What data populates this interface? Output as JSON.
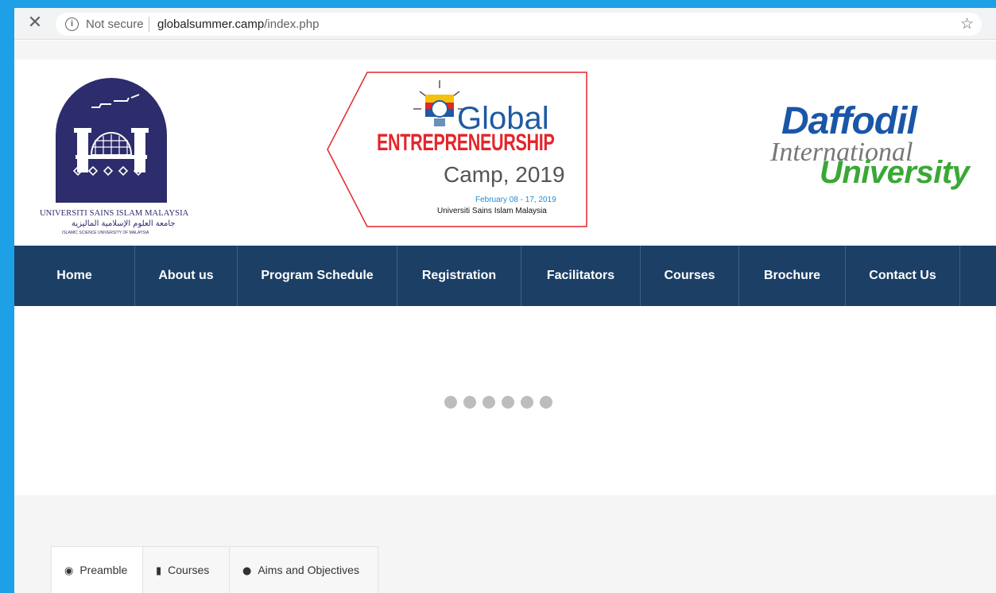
{
  "browser": {
    "close_glyph": "✕",
    "info_glyph": "i",
    "security_label": "Not secure",
    "url_host": "globalsummer.camp",
    "url_path": "/index.php",
    "star_glyph": "☆"
  },
  "header": {
    "usim": {
      "name": "UNIVERSITI SAINS ISLAM MALAYSIA",
      "arabic": "جامعة العلوم الإسلامية الماليزية",
      "english": "ISLAMIC SCIENCE UNIVERSITY OF MALAYSIA"
    },
    "gec": {
      "global": "Global",
      "entrepreneurship": "ENTREPRENEURSHIP",
      "camp": "Camp, 2019",
      "date": "February 08 - 17, 2019",
      "university": "Universiti Sains Islam Malaysia"
    },
    "daffodil": {
      "line1": "Daffodil",
      "line2": "International",
      "line3": "University"
    }
  },
  "nav": {
    "items": [
      {
        "label": "Home"
      },
      {
        "label": "About us"
      },
      {
        "label": "Program Schedule"
      },
      {
        "label": "Registration"
      },
      {
        "label": "Facilitators"
      },
      {
        "label": "Courses"
      },
      {
        "label": "Brochure"
      },
      {
        "label": "Contact Us"
      }
    ]
  },
  "slider": {
    "dot_count": 6,
    "dot_color": "#bdbdbd"
  },
  "tabs": {
    "items": [
      {
        "label": "Preamble",
        "icon": "dot-circle-icon",
        "glyph": "◉",
        "active": true
      },
      {
        "label": "Courses",
        "icon": "book-icon",
        "glyph": "▮",
        "active": false
      },
      {
        "label": "Aims and Objectives",
        "icon": "globe-icon",
        "glyph": "●",
        "active": false
      }
    ]
  },
  "colors": {
    "nav_bg": "#1c3f66",
    "frame_border": "#1ea0e6",
    "gec_red": "#e3262b",
    "gec_blue": "#1f5aa3",
    "daffodil_blue": "#1a56a8",
    "daffodil_green": "#3aa835"
  }
}
